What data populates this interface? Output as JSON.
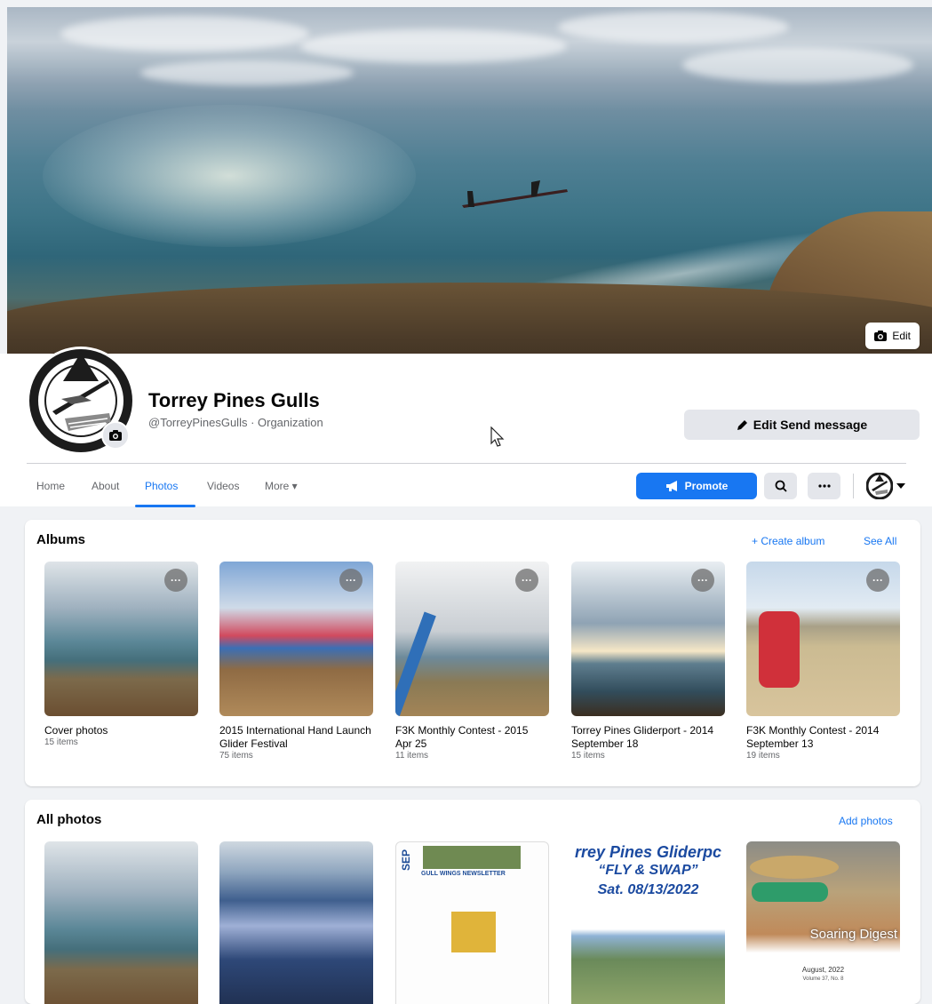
{
  "cover": {
    "edit_label": "Edit"
  },
  "page": {
    "name": "Torrey Pines Gulls",
    "handle_category": "@TorreyPinesGulls · Organization",
    "edit_send_label": "Edit Send message"
  },
  "nav": {
    "tabs": [
      "Home",
      "About",
      "Photos",
      "Videos",
      "More ▾"
    ],
    "active_tab": "Photos",
    "promote_label": "Promote"
  },
  "albums": {
    "title": "Albums",
    "create_label": "+ Create album",
    "see_all_label": "See All",
    "items": [
      {
        "title": "Cover photos",
        "count": "15 items"
      },
      {
        "title": "2015 International Hand Launch Glider Festival",
        "count": "75 items"
      },
      {
        "title": "F3K Monthly Contest - 2015 Apr 25",
        "count": "11 items"
      },
      {
        "title": "Torrey Pines Gliderport - 2014 September 18",
        "count": "15 items"
      },
      {
        "title": "F3K Monthly Contest - 2014 September 13",
        "count": "19 items"
      }
    ]
  },
  "all_photos": {
    "title": "All photos",
    "add_label": "Add photos",
    "photos": [
      {
        "kind": "coastal photo"
      },
      {
        "kind": "sparkling sea photo"
      },
      {
        "kind": "newsletter",
        "lines": [
          "SEP",
          "GULL WINGS NEWSLETTER"
        ]
      },
      {
        "kind": "event poster",
        "lines": [
          "rrey Pines Gliderpc",
          "“FLY & SWAP”",
          "Sat. 08/13/2022"
        ]
      },
      {
        "kind": "magazine cover",
        "lines": [
          "Soaring Digest",
          "August, 2022",
          "Volume 37, No. 8"
        ]
      }
    ]
  },
  "colors": {
    "accent": "#1877f2",
    "card_bg": "#ffffff",
    "page_bg": "#f0f2f5",
    "secondary_text": "#65676b"
  },
  "icons": [
    "camera-icon",
    "pencil-icon",
    "megaphone-icon",
    "search-icon",
    "more-icon",
    "chevron-down-icon",
    "cursor-icon"
  ]
}
